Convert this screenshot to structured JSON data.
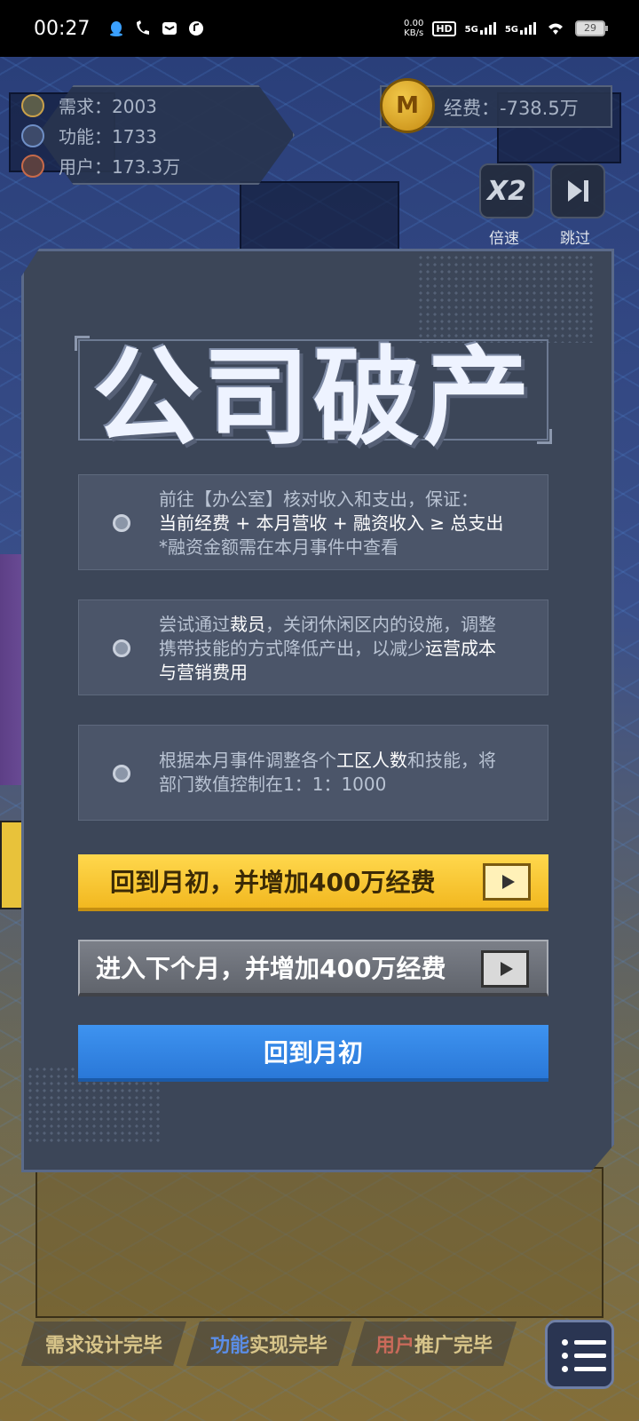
{
  "status_bar": {
    "time": "00:27",
    "net_speed_value": "0.00",
    "net_speed_unit": "KB/s",
    "hd_badge": "HD",
    "signal1": "5G",
    "signal2": "5G",
    "battery": "29"
  },
  "hud": {
    "demand_label": "需求：2003",
    "function_label": "功能：1733",
    "users_label": "用户：173.3万",
    "funds_label": "经费：-738.5万",
    "coin_symbol": "M",
    "speed_button": "X2",
    "speed_caption": "倍速",
    "skip_caption": "跳过"
  },
  "modal": {
    "title": "公司破产",
    "options": [
      {
        "line1": "前往【办公室】核对收入和支出，保证：",
        "line2": "当前经费 + 本月营收 + 融资收入 ≥ 总支出",
        "line3": "*融资金额需在本月事件中查看"
      },
      {
        "line1_a": "尝试通过",
        "line1_b": "裁员",
        "line1_c": "，关闭休闲区内的设施，调整",
        "line2_a": "携带技能的方式降低产出，以减少",
        "line2_b": "运营成本",
        "line3": "与营销费用"
      },
      {
        "line1_a": "根据本月事件调整各个",
        "line1_b": "工区人数",
        "line1_c": "和技能，将",
        "line2": "部门数值控制在1：1：1000"
      }
    ],
    "btn_back_bonus": "回到月初，并增加400万经费",
    "btn_next_bonus": "进入下个月，并增加400万经费",
    "btn_back": "回到月初"
  },
  "bottom_tabs": {
    "tab1_a": "需求",
    "tab1_b": "设计完毕",
    "tab2_a": "功能",
    "tab2_b": "实现完毕",
    "tab3_a": "用户",
    "tab3_b": "推广完毕"
  },
  "colors": {
    "accent_yellow": "#f2b820",
    "accent_blue": "#2a78d8",
    "modal_bg": "#3c4658"
  },
  "icons": {
    "demand": "lightbulb-icon",
    "function": "wrench-icon",
    "users": "person-icon",
    "coin": "coin-icon",
    "video": "video-ad-icon",
    "menu": "menu-list-icon"
  }
}
